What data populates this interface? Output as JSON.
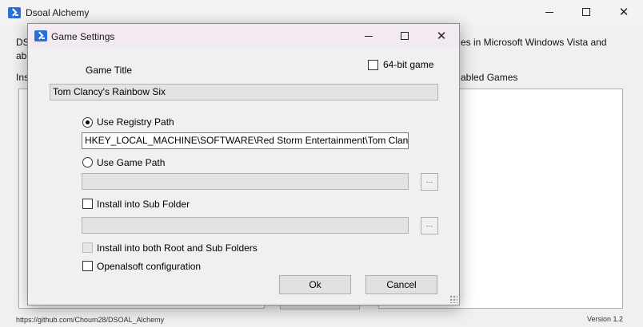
{
  "main_window": {
    "title": "Dsoal Alchemy",
    "intro_left_fragment_1": "DS",
    "intro_left_fragment_2": "ab",
    "intro_right_fragment": "es in Microsoft Windows Vista and",
    "installed_label_fragment": "Ins",
    "enabled_label_fragment": "abled Games",
    "status_url": "https://github.com/Choum28/DSOAL_Alchemy",
    "version": "Version 1.2"
  },
  "dialog": {
    "title": "Game Settings",
    "game_title_label": "Game Title",
    "game_title_value": "Tom Clancy's Rainbow Six",
    "bit64_label": "64-bit game",
    "bit64_checked": false,
    "use_registry_label": "Use Registry Path",
    "use_registry_selected": true,
    "registry_path_value": "HKEY_LOCAL_MACHINE\\SOFTWARE\\Red Storm Entertainment\\Tom Clancy's",
    "use_game_path_label": "Use Game Path",
    "game_path_value": "",
    "browse_label": "...",
    "install_sub_label": "Install into Sub Folder",
    "sub_folder_value": "",
    "install_both_label": "Install into both Root and Sub Folders",
    "openal_label": "Openalsoft configuration",
    "ok_label": "Ok",
    "cancel_label": "Cancel"
  }
}
